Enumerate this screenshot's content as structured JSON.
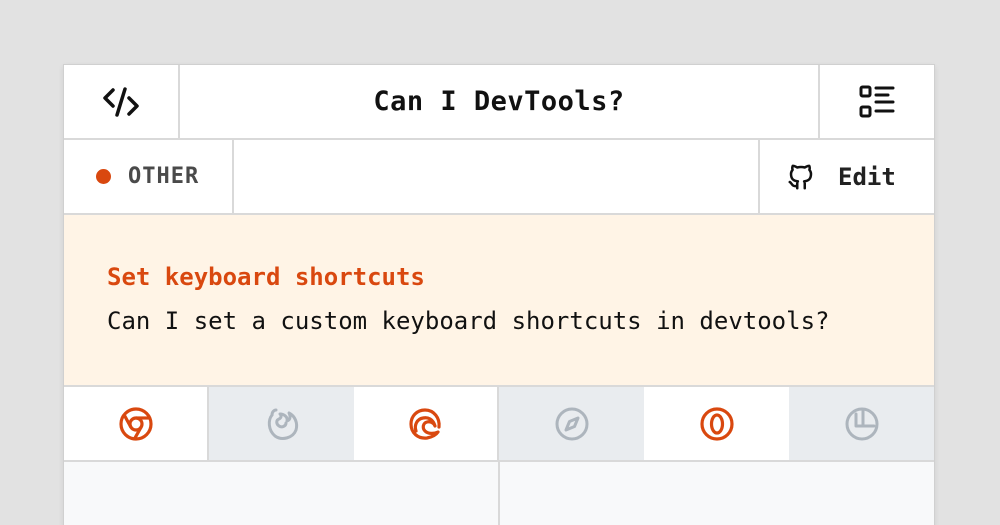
{
  "header": {
    "title": "Can I DevTools?",
    "left_icon": "code-icon",
    "right_icon": "list-icon"
  },
  "subbar": {
    "category": "OTHER",
    "category_color": "#d9480f",
    "edit_label": "Edit",
    "edit_icon": "github-icon"
  },
  "feature": {
    "title": "Set keyboard shortcuts",
    "question": "Can I set a custom keyboard shortcuts in devtools?",
    "background": "#fff4e6"
  },
  "browsers": [
    {
      "name": "chrome",
      "supported": true
    },
    {
      "name": "firefox",
      "supported": false
    },
    {
      "name": "edge",
      "supported": true
    },
    {
      "name": "safari",
      "supported": false
    },
    {
      "name": "opera",
      "supported": true
    },
    {
      "name": "polypane",
      "supported": false
    }
  ],
  "colors": {
    "accent": "#d9480f",
    "unsupported": "#adb5bd"
  }
}
